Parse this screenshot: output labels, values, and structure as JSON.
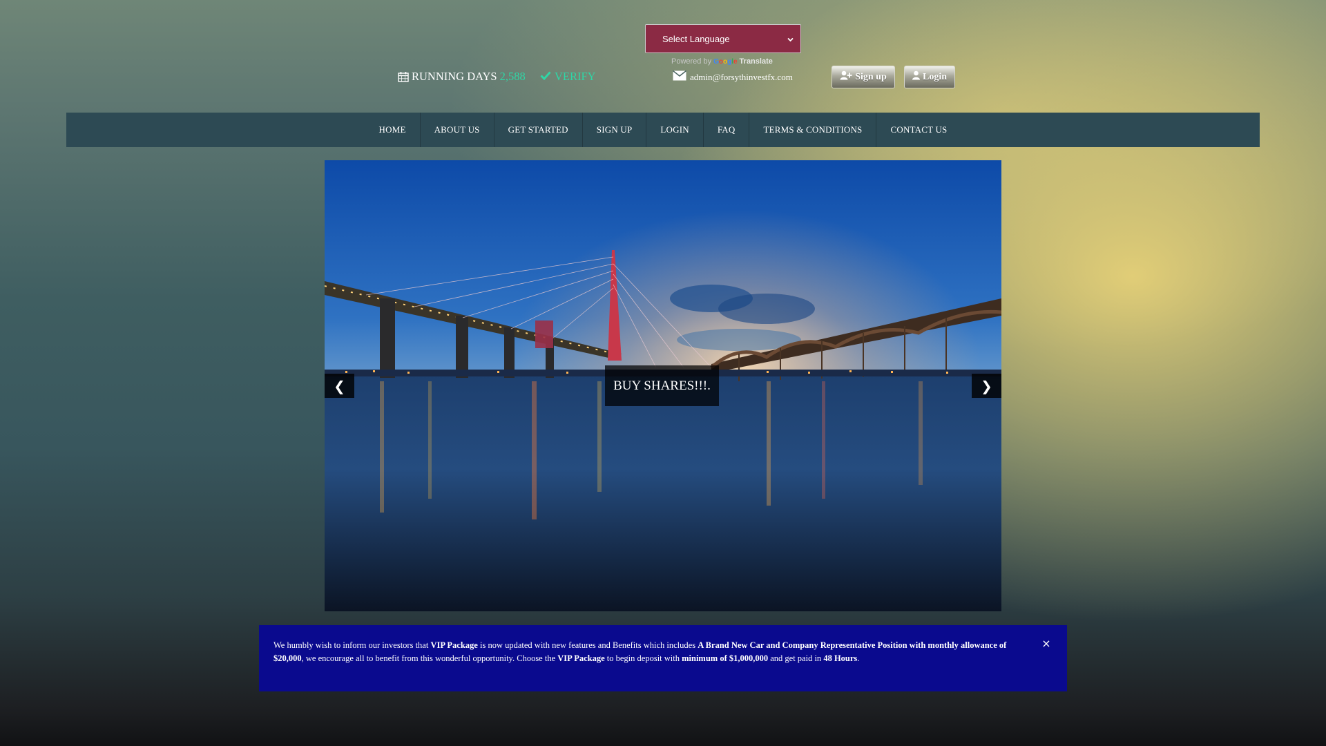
{
  "header": {
    "running_days_label": "RUNNING DAYS",
    "running_days_value": "2,588",
    "verify_label": "VERIFY",
    "language_select": "Select Language",
    "powered_by": "Powered by",
    "google": "Google",
    "translate": "Translate",
    "email": "admin@forsythinvestfx.com",
    "signup_label": "Sign up",
    "login_label": "Login"
  },
  "nav": {
    "items": [
      "HOME",
      "ABOUT US",
      "GET STARTED",
      "SIGN UP",
      "LOGIN",
      "FAQ",
      "TERMS & CONDITIONS",
      "CONTACT US"
    ]
  },
  "slider": {
    "caption": "BUY SHARES!!!.",
    "prev": "❮",
    "next": "❯"
  },
  "notice": {
    "p1": "We humbly wish to inform our investors that ",
    "b1": "VIP Package",
    "p2": " is now updated with new features and Benefits which includes ",
    "b2": "A Brand New Car and Company Representative Position with monthly allowance of $20,000",
    "p3": ", we encourage all to benefit from this wonderful opportunity. Choose the ",
    "b3": "VIP Package",
    "p4": " to begin deposit with ",
    "b4": "minimum of $1,000,000",
    "p5": " and get paid in ",
    "b5": "48 Hours",
    "p6": ".",
    "close": "×"
  },
  "colors": {
    "accent": "#2fd6a6",
    "nav_bg": "#2d4a54",
    "language_bg": "#8b2a44",
    "notice_bg": "#0a0a8e"
  }
}
